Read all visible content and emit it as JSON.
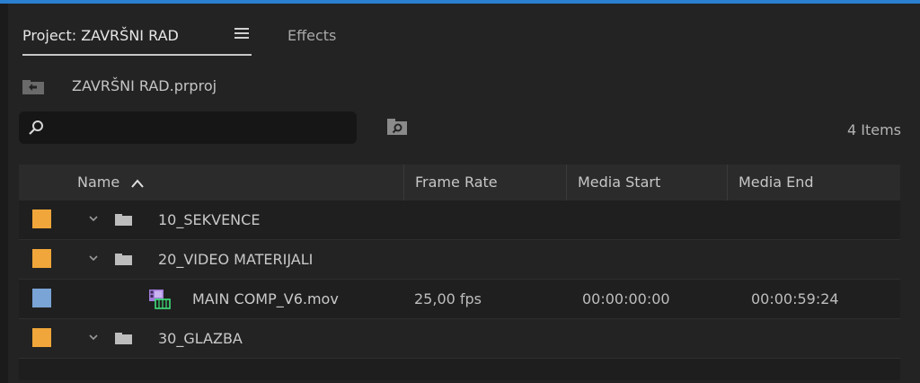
{
  "panel": {
    "tabs": {
      "project_label": "Project: ZAVRŠNI RAD",
      "effects_label": "Effects"
    },
    "project_file": "ZAVRŠNI RAD.prproj",
    "search": {
      "value": "",
      "placeholder": ""
    },
    "item_count": "4 Items"
  },
  "table": {
    "columns": {
      "name": "Name",
      "frame_rate": "Frame Rate",
      "media_start": "Media Start",
      "media_end": "Media End"
    },
    "rows": [
      {
        "type": "bin",
        "name": "10_SEKVENCE",
        "label_color": "#f0a63a",
        "frame_rate": "",
        "media_start": "",
        "media_end": ""
      },
      {
        "type": "bin",
        "name": "20_VIDEO MATERIJALI",
        "label_color": "#f0a63a",
        "frame_rate": "",
        "media_start": "",
        "media_end": ""
      },
      {
        "type": "clip",
        "name": "MAIN COMP_V6.mov",
        "label_color": "#7aa3d6",
        "frame_rate": "25,00 fps",
        "media_start": "00:00:00:00",
        "media_end": "00:00:59:24"
      },
      {
        "type": "bin",
        "name": "30_GLAZBA",
        "label_color": "#f0a63a",
        "frame_rate": "",
        "media_start": "",
        "media_end": ""
      }
    ]
  },
  "icons": {
    "menu": "hamburger-icon",
    "up": "folder-up-icon",
    "search": "search-icon",
    "bin_search": "bin-search-icon",
    "sort": "sort-ascending-icon",
    "chevron": "chevron-down-icon",
    "folder": "folder-icon",
    "clip": "video-clip-icon"
  },
  "colors": {
    "accent": "#2a7fd0",
    "bin_label": "#f0a63a",
    "clip_label": "#7aa3d6"
  }
}
